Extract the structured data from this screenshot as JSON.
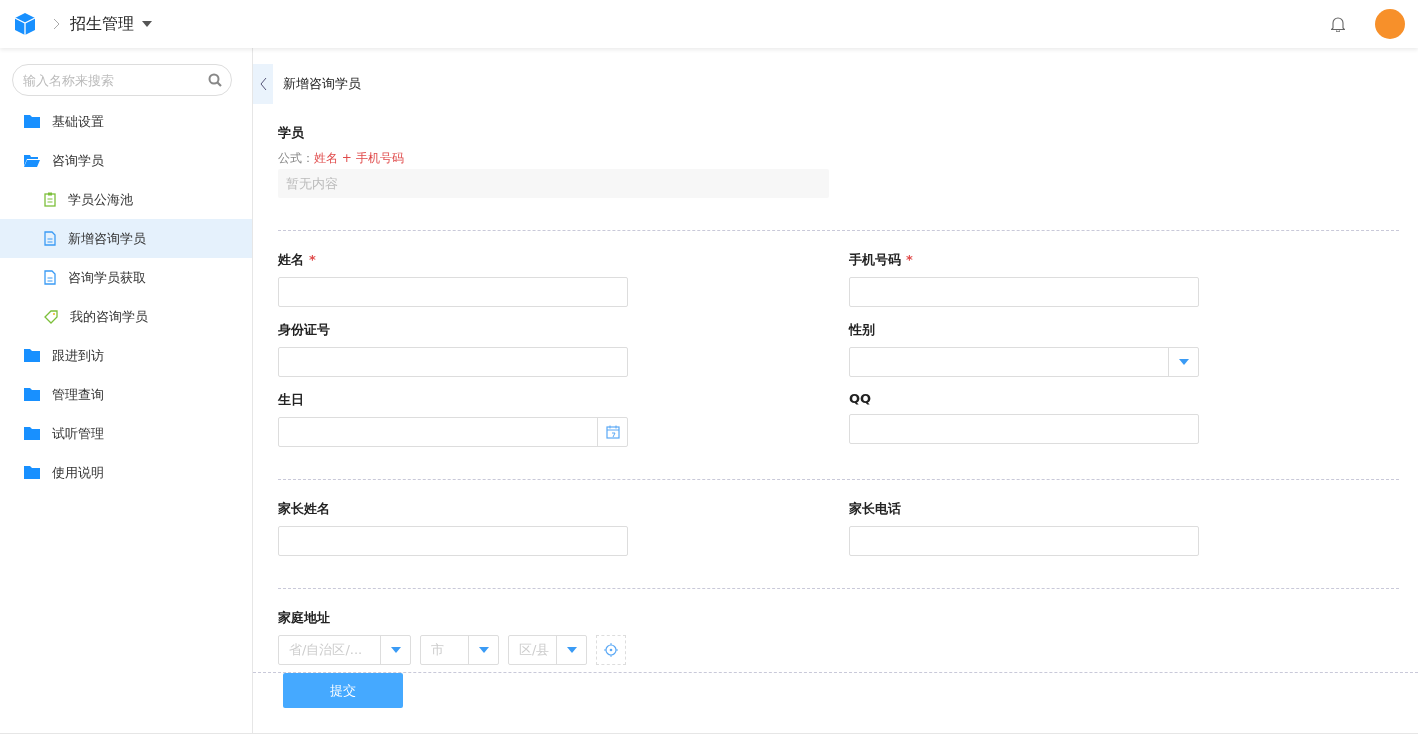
{
  "header": {
    "module": "招生管理"
  },
  "sidebar": {
    "search": {
      "placeholder": "输入名称来搜索"
    },
    "items": [
      {
        "label": "基础设置",
        "kind": "folder",
        "expanded": false,
        "selected": false
      },
      {
        "label": "咨询学员",
        "kind": "folder",
        "expanded": true,
        "selected": false,
        "children": [
          {
            "label": "学员公海池",
            "kind": "clipboard",
            "selected": false
          },
          {
            "label": "新增咨询学员",
            "kind": "document",
            "selected": true
          },
          {
            "label": "咨询学员获取",
            "kind": "document",
            "selected": false
          },
          {
            "label": "我的咨询学员",
            "kind": "tag",
            "selected": false
          }
        ]
      },
      {
        "label": "跟进到访",
        "kind": "folder",
        "expanded": false,
        "selected": false
      },
      {
        "label": "管理查询",
        "kind": "folder",
        "expanded": false,
        "selected": false
      },
      {
        "label": "试听管理",
        "kind": "folder",
        "expanded": false,
        "selected": false
      },
      {
        "label": "使用说明",
        "kind": "folder",
        "expanded": false,
        "selected": false
      }
    ]
  },
  "page": {
    "title": "新增咨询学员",
    "student": {
      "label": "学员",
      "formula_label": "公式：",
      "formula": "姓名 + 手机号码",
      "empty": "暂无内容"
    },
    "sections": [
      [
        {
          "label": "姓名",
          "kind": "text",
          "required_mark": "*"
        },
        {
          "label": "手机号码",
          "kind": "text",
          "required_mark": "*"
        },
        {
          "label": "身份证号",
          "kind": "text"
        },
        {
          "label": "性别",
          "kind": "select"
        },
        {
          "label": "生日",
          "kind": "date"
        },
        {
          "label": "QQ",
          "kind": "text"
        }
      ],
      [
        {
          "label": "家长姓名",
          "kind": "text"
        },
        {
          "label": "家长电话",
          "kind": "text"
        }
      ]
    ],
    "address": {
      "label": "家庭地址",
      "selects": [
        "省/自治区/...",
        "市",
        "区/县"
      ]
    },
    "submit": "提交"
  }
}
